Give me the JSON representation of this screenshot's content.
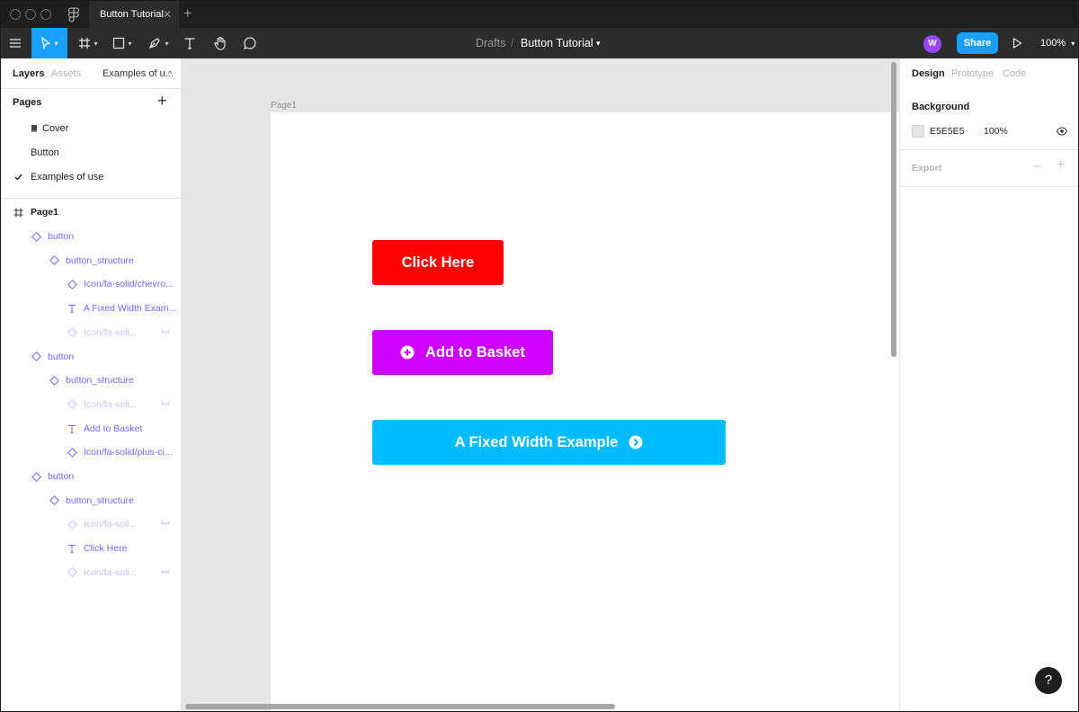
{
  "tab": {
    "title": "Button Tutorial",
    "close": "✕",
    "add": "+"
  },
  "toolbar": {
    "breadcrumb_parent": "Drafts",
    "breadcrumb_sep": "/",
    "file_name": "Button Tutorial",
    "file_caret": "▾",
    "avatar_initial": "W",
    "share_label": "Share",
    "zoom": "100%",
    "zoom_caret": "▾"
  },
  "left_panel": {
    "tabs": [
      "Layers",
      "Assets"
    ],
    "current_page_tab": "Examples of u...",
    "pages_title": "Pages",
    "pages_add": "+",
    "pages": [
      {
        "label": "Cover",
        "icon": "book-icon"
      },
      {
        "label": "Button"
      },
      {
        "label": "Examples of use",
        "checked": true
      }
    ],
    "frame_name": "Page1",
    "layers": [
      {
        "label": "button",
        "kind": "component"
      },
      {
        "label": "button_structure",
        "kind": "component"
      },
      {
        "label": "Icon/fa-solid/chevro...",
        "kind": "component"
      },
      {
        "label": "A Fixed Width Exam...",
        "kind": "text"
      },
      {
        "label": "Icon/fa-soli...",
        "kind": "component",
        "hidden": true
      },
      {
        "label": "button",
        "kind": "component"
      },
      {
        "label": "button_structure",
        "kind": "component"
      },
      {
        "label": "Icon/fa-soli...",
        "kind": "component",
        "hidden": true
      },
      {
        "label": "Add to Basket",
        "kind": "text"
      },
      {
        "label": "Icon/fa-solid/plus-ci...",
        "kind": "component"
      },
      {
        "label": "button",
        "kind": "component"
      },
      {
        "label": "button_structure",
        "kind": "component"
      },
      {
        "label": "Icon/fa-soli...",
        "kind": "component",
        "hidden": true
      },
      {
        "label": "Click Here",
        "kind": "text"
      },
      {
        "label": "Icon/fa-soli...",
        "kind": "component",
        "hidden": true
      }
    ]
  },
  "canvas": {
    "frame_label": "Page1",
    "buttons": [
      {
        "label": "Click Here",
        "color": "#ff0000"
      },
      {
        "label": "Add to Basket",
        "color": "#cc00ff",
        "icon": "plus-circle-icon"
      },
      {
        "label": "A Fixed Width Example",
        "color": "#00bbff",
        "icon": "chevron-circle-right-icon"
      }
    ]
  },
  "right_panel": {
    "tabs": [
      "Design",
      "Prototype",
      "Code"
    ],
    "background_title": "Background",
    "background_hex": "E5E5E5",
    "background_opacity": "100%",
    "export_title": "Export",
    "export_minus": "−",
    "export_plus": "+"
  },
  "help_label": "?",
  "colors": {
    "accent": "#18a0fb",
    "layer_purple": "#7b61ff",
    "avatar": "#9747ff"
  }
}
